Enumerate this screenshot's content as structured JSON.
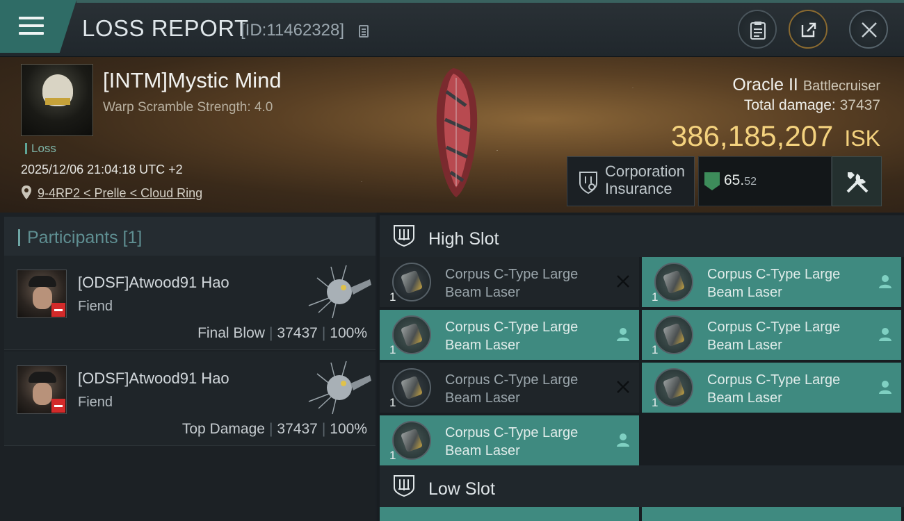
{
  "header": {
    "title": "LOSS REPORT",
    "report_id": "[ID:11462328]"
  },
  "victim": {
    "name": "[INTM]Mystic Mind",
    "warp_scramble": "Warp Scramble Strength: 4.0",
    "tag": "Loss",
    "datetime": "2025/12/06 21:04:18 UTC +2",
    "location": "9-4RP2 < Prelle < Cloud Ring"
  },
  "ship": {
    "name": "Oracle II",
    "class": "Battlecruiser",
    "total_damage_label": "Total damage:",
    "total_damage": "37437",
    "value": "386,185,207",
    "value_unit": "ISK"
  },
  "insurance": {
    "label_line1": "Corporation",
    "label_line2": "Insurance",
    "value_main": "65.",
    "value_decimal": "52"
  },
  "participants": {
    "title": "Participants [1]",
    "rows": [
      {
        "name": "[ODSF]Atwood91 Hao",
        "ship": "Fiend",
        "role": "Final Blow",
        "damage": "37437",
        "percent": "100%"
      },
      {
        "name": "[ODSF]Atwood91 Hao",
        "ship": "Fiend",
        "role": "Top Damage",
        "damage": "37437",
        "percent": "100%"
      }
    ]
  },
  "slots": {
    "high": {
      "label": "High Slot",
      "modules": [
        {
          "line1": "Corpus C-Type Large",
          "line2": "Beam Laser",
          "qty": "1",
          "status": "destroyed"
        },
        {
          "line1": "Corpus C-Type Large",
          "line2": "Beam Laser",
          "qty": "1",
          "status": "dropped"
        },
        {
          "line1": "Corpus C-Type Large",
          "line2": "Beam Laser",
          "qty": "1",
          "status": "dropped"
        },
        {
          "line1": "Corpus C-Type Large",
          "line2": "Beam Laser",
          "qty": "1",
          "status": "dropped"
        },
        {
          "line1": "Corpus C-Type Large",
          "line2": "Beam Laser",
          "qty": "1",
          "status": "destroyed"
        },
        {
          "line1": "Corpus C-Type Large",
          "line2": "Beam Laser",
          "qty": "1",
          "status": "dropped"
        },
        {
          "line1": "Corpus C-Type Large",
          "line2": "Beam Laser",
          "qty": "1",
          "status": "dropped"
        }
      ]
    },
    "low": {
      "label": "Low Slot"
    }
  },
  "colors": {
    "accent": "#3f8a80",
    "isk": "#f4d27e",
    "loss_badge": "#d32a2a"
  },
  "icons": {
    "menu": "menu-icon",
    "copy": "copy-icon",
    "clipboard": "clipboard-icon",
    "share": "share-icon",
    "close": "close-icon",
    "location": "location-pin-icon",
    "fitting": "wrench-screwdriver-icon",
    "slot": "slot-icon",
    "destroyed": "x-icon",
    "dropped": "person-icon"
  }
}
